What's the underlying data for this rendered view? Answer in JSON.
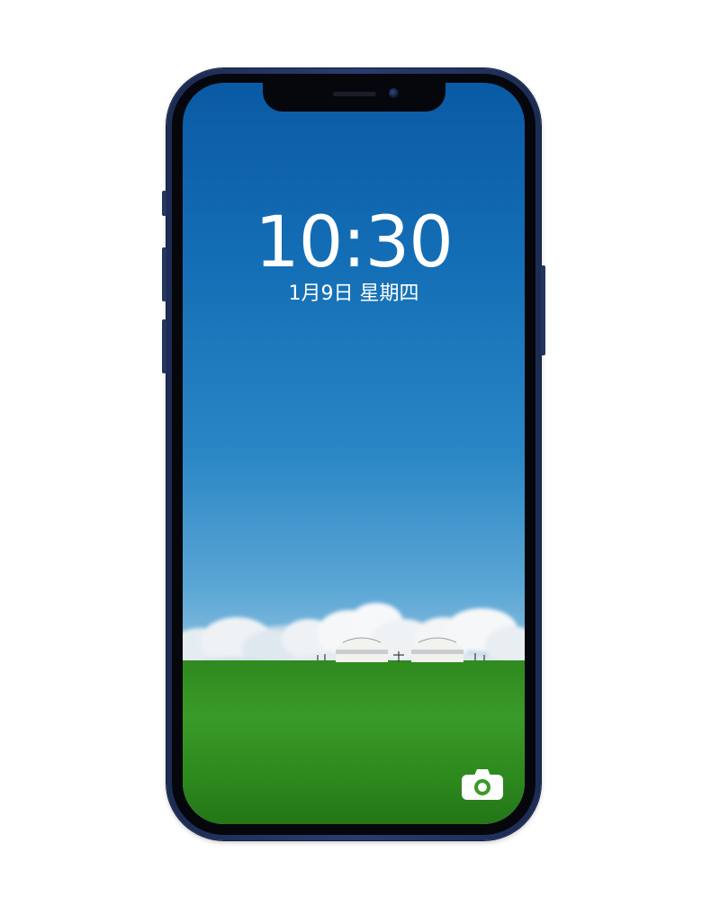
{
  "lock_screen": {
    "time": "10:30",
    "date": "1月9日 星期四"
  },
  "icons": {
    "camera": "camera-icon"
  },
  "colors": {
    "sky_top": "#0a5aa4",
    "sky_horizon": "#8cc0e0",
    "grass": "#3a9a28",
    "phone_frame": "#1c2b52",
    "text": "#ffffff"
  }
}
